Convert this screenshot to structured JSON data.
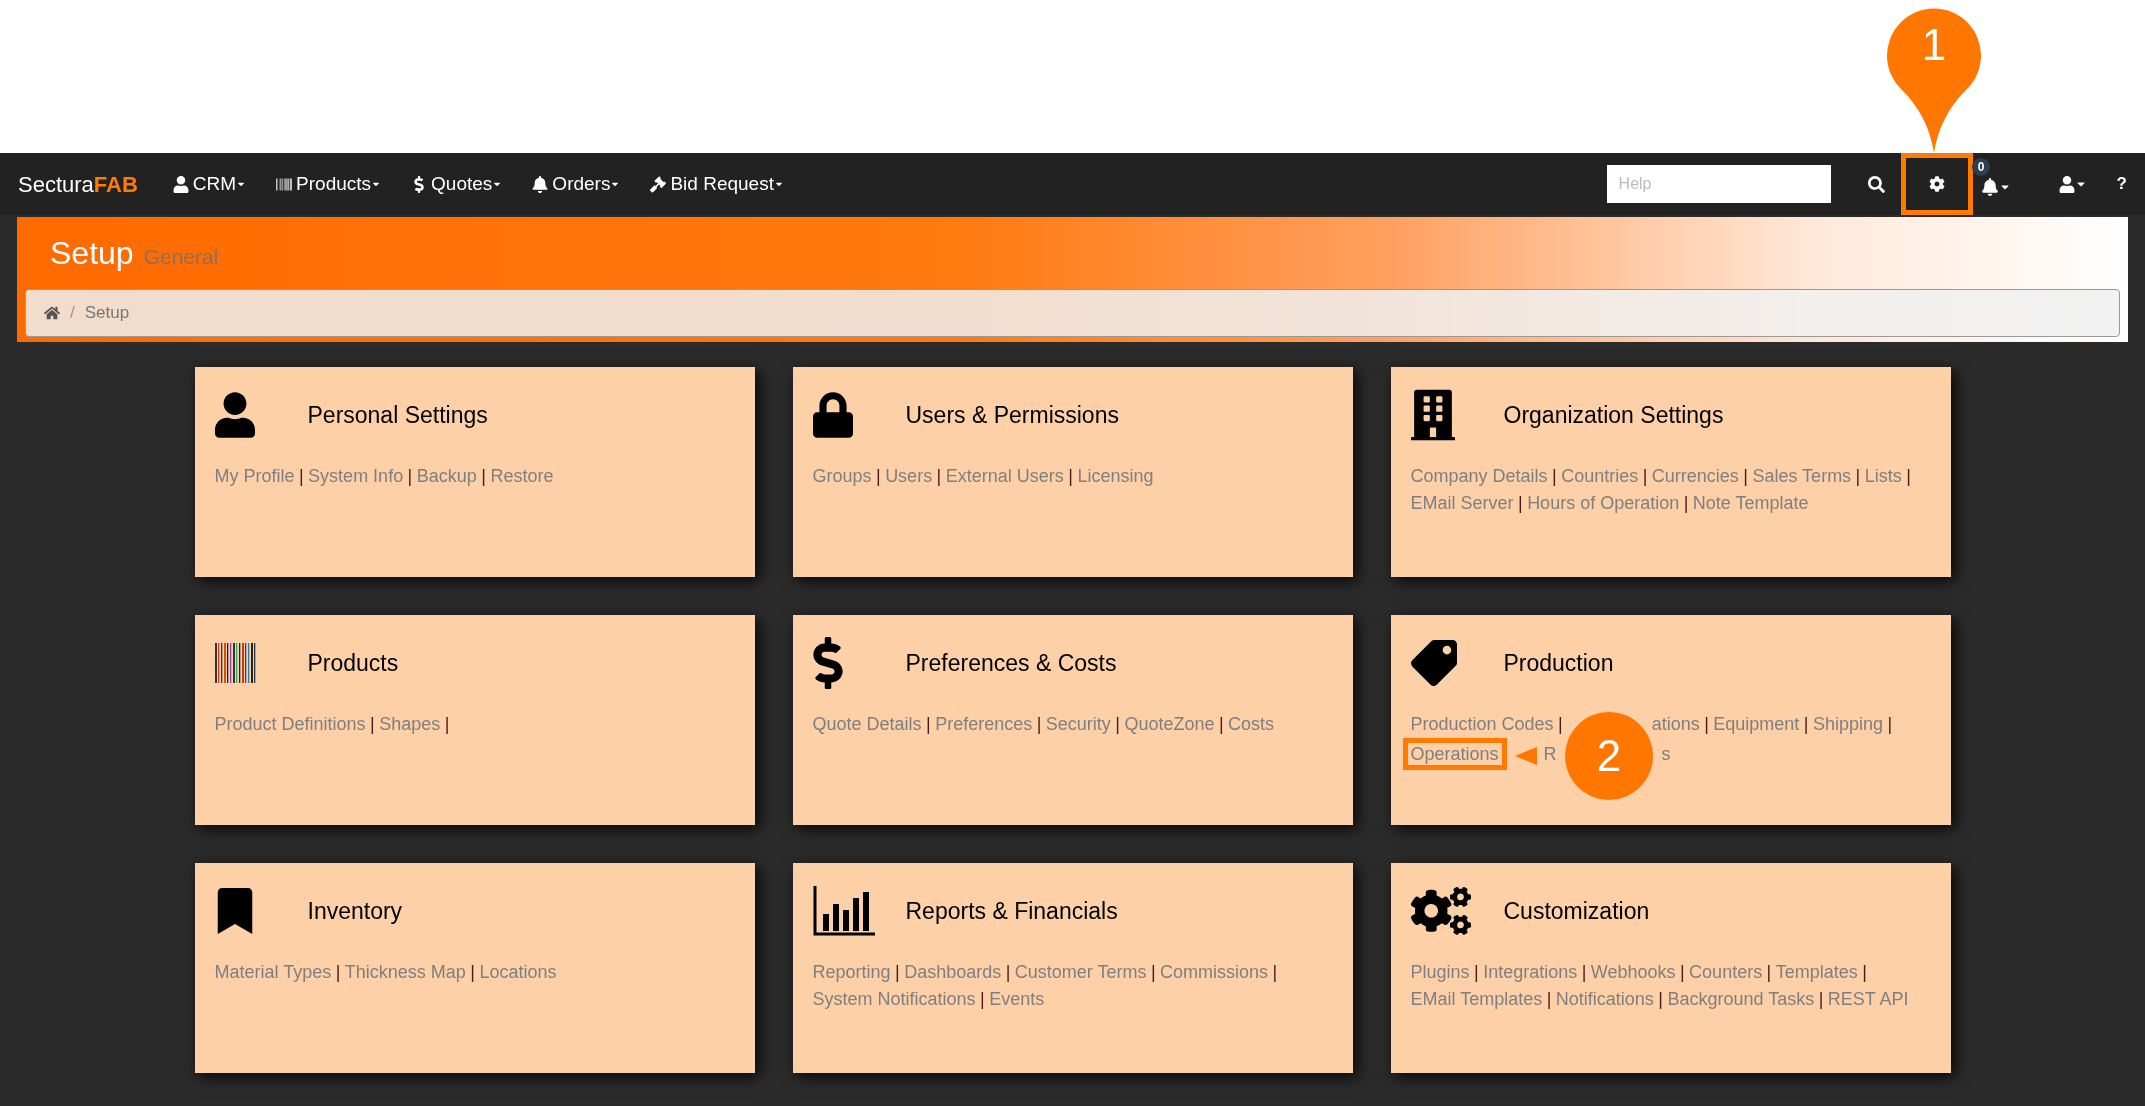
{
  "navbar": {
    "brand": {
      "first": "Sectura",
      "second": "FAB"
    },
    "menus": [
      {
        "label": "CRM"
      },
      {
        "label": "Products"
      },
      {
        "label": "Quotes"
      },
      {
        "label": "Orders"
      },
      {
        "label": "Bid Request"
      }
    ],
    "help_search": {
      "placeholder": "Help"
    },
    "notification_count": "0",
    "settings_highlighted": true,
    "help_label": "?"
  },
  "callout_top": {
    "number": "1"
  },
  "header": {
    "title": "Setup",
    "subtitle": "General",
    "breadcrumb": {
      "separator": "/",
      "current": "Setup"
    }
  },
  "cards": [
    {
      "title": "Personal Settings",
      "parts": [
        {
          "kind": "link",
          "text": "My Profile"
        },
        {
          "kind": "separator",
          "text": "|"
        },
        {
          "kind": "link",
          "text": "System Info"
        },
        {
          "kind": "separator",
          "text": "|"
        },
        {
          "kind": "link",
          "text": "Backup"
        },
        {
          "kind": "separator",
          "text": "|"
        },
        {
          "kind": "link",
          "text": "Restore"
        }
      ]
    },
    {
      "title": "Users & Permissions",
      "parts": [
        {
          "kind": "link",
          "text": "Groups"
        },
        {
          "kind": "separator",
          "text": "|"
        },
        {
          "kind": "link",
          "text": "Users"
        },
        {
          "kind": "separator",
          "text": "|"
        },
        {
          "kind": "link",
          "text": "External Users"
        },
        {
          "kind": "separator",
          "text": "|"
        },
        {
          "kind": "link",
          "text": "Licensing"
        }
      ]
    },
    {
      "title": "Organization Settings",
      "parts": [
        {
          "kind": "link",
          "text": "Company Details"
        },
        {
          "kind": "separator",
          "text": "|"
        },
        {
          "kind": "link",
          "text": "Countries"
        },
        {
          "kind": "separator",
          "text": "|"
        },
        {
          "kind": "link",
          "text": "Currencies"
        },
        {
          "kind": "separator",
          "text": "|"
        },
        {
          "kind": "link",
          "text": "Sales Terms"
        },
        {
          "kind": "separator",
          "text": "|"
        },
        {
          "kind": "link",
          "text": "Lists"
        },
        {
          "kind": "separator",
          "text": "|"
        },
        {
          "kind": "link",
          "text": "EMail Server"
        },
        {
          "kind": "separator",
          "text": "|"
        },
        {
          "kind": "link",
          "text": "Hours of Operation"
        },
        {
          "kind": "separator",
          "text": "|"
        },
        {
          "kind": "link",
          "text": "Note Template"
        }
      ]
    },
    {
      "title": "Products",
      "parts": [
        {
          "kind": "link",
          "text": "Product Definitions"
        },
        {
          "kind": "separator",
          "text": "|"
        },
        {
          "kind": "link",
          "text": "Shapes"
        },
        {
          "kind": "separator",
          "text": "|"
        }
      ]
    },
    {
      "title": "Preferences & Costs",
      "parts": [
        {
          "kind": "link",
          "text": "Quote Details"
        },
        {
          "kind": "separator",
          "text": "|"
        },
        {
          "kind": "link",
          "text": "Preferences"
        },
        {
          "kind": "separator",
          "text": "|"
        },
        {
          "kind": "link",
          "text": "Security"
        },
        {
          "kind": "separator",
          "text": "|"
        },
        {
          "kind": "link",
          "text": "QuoteZone"
        },
        {
          "kind": "separator",
          "text": "|"
        },
        {
          "kind": "link",
          "text": "Costs"
        }
      ]
    },
    {
      "title": "Production",
      "parts": [
        {
          "kind": "link",
          "text": "Production Codes"
        },
        {
          "kind": "separator",
          "text": "|"
        },
        {
          "kind": "hidden"
        },
        {
          "kind": "link",
          "text": "ations"
        },
        {
          "kind": "separator",
          "text": "|"
        },
        {
          "kind": "link",
          "text": "Equipment"
        },
        {
          "kind": "separator",
          "text": "|"
        },
        {
          "kind": "link",
          "text": "Shipping"
        },
        {
          "kind": "separator",
          "text": "|"
        },
        {
          "kind": "link",
          "text": "Operations",
          "highlighted": true
        },
        {
          "kind": "pointer"
        },
        {
          "kind": "link",
          "text": "R"
        },
        {
          "kind": "callout",
          "number": "2"
        },
        {
          "kind": "link",
          "text": "s"
        }
      ]
    },
    {
      "title": "Inventory",
      "parts": [
        {
          "kind": "link",
          "text": "Material Types"
        },
        {
          "kind": "separator",
          "text": "|"
        },
        {
          "kind": "link",
          "text": "Thickness Map"
        },
        {
          "kind": "separator",
          "text": "|"
        },
        {
          "kind": "link",
          "text": "Locations"
        }
      ]
    },
    {
      "title": "Reports & Financials",
      "parts": [
        {
          "kind": "link",
          "text": "Reporting"
        },
        {
          "kind": "separator",
          "text": "|"
        },
        {
          "kind": "link",
          "text": "Dashboards"
        },
        {
          "kind": "separator",
          "text": "|"
        },
        {
          "kind": "link",
          "text": "Customer Terms"
        },
        {
          "kind": "separator",
          "text": "|"
        },
        {
          "kind": "link",
          "text": "Commissions"
        },
        {
          "kind": "separator",
          "text": "|"
        },
        {
          "kind": "link",
          "text": "System Notifications"
        },
        {
          "kind": "separator",
          "text": "|"
        },
        {
          "kind": "link",
          "text": "Events"
        }
      ]
    },
    {
      "title": "Customization",
      "parts": [
        {
          "kind": "link",
          "text": "Plugins"
        },
        {
          "kind": "separator",
          "text": "|"
        },
        {
          "kind": "link",
          "text": "Integrations"
        },
        {
          "kind": "separator",
          "text": "|"
        },
        {
          "kind": "link",
          "text": "Webhooks"
        },
        {
          "kind": "separator",
          "text": "|"
        },
        {
          "kind": "link",
          "text": "Counters"
        },
        {
          "kind": "separator",
          "text": "|"
        },
        {
          "kind": "link",
          "text": "Templates"
        },
        {
          "kind": "separator",
          "text": "|"
        },
        {
          "kind": "link",
          "text": "EMail Templates"
        },
        {
          "kind": "separator",
          "text": "|"
        },
        {
          "kind": "link",
          "text": "Notifications"
        },
        {
          "kind": "separator",
          "text": "|"
        },
        {
          "kind": "link",
          "text": "Background Tasks"
        },
        {
          "kind": "separator",
          "text": "|"
        },
        {
          "kind": "link",
          "text": "REST API"
        }
      ]
    }
  ]
}
